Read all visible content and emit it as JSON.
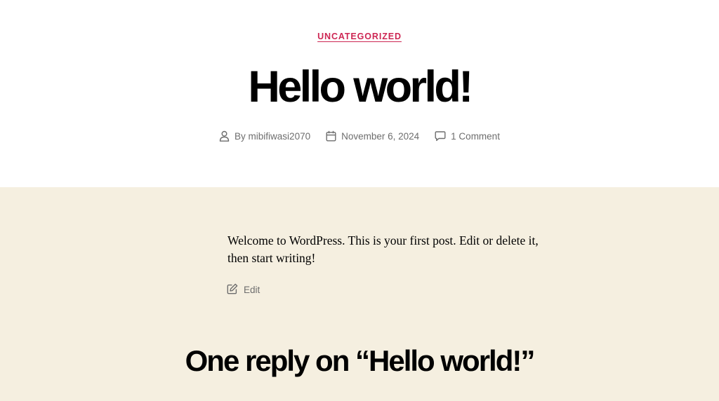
{
  "post": {
    "category": "UNCATEGORIZED",
    "title": "Hello world!",
    "meta": {
      "author": "By mibifiwasi2070",
      "date": "November 6, 2024",
      "comments": "1 Comment"
    },
    "content": "Welcome to WordPress. This is your first post. Edit or delete it, then start writing!",
    "edit_label": "Edit"
  },
  "comments_section": {
    "title": "One reply on “Hello world!”"
  },
  "icons": {
    "author": "user-icon",
    "date": "calendar-icon",
    "comments": "speech-bubble-icon",
    "edit": "pencil-square-icon"
  },
  "colors": {
    "accent": "#cd2653",
    "meta_text": "#6d6d6d",
    "content_background": "#f5efe0",
    "header_background": "#ffffff"
  }
}
